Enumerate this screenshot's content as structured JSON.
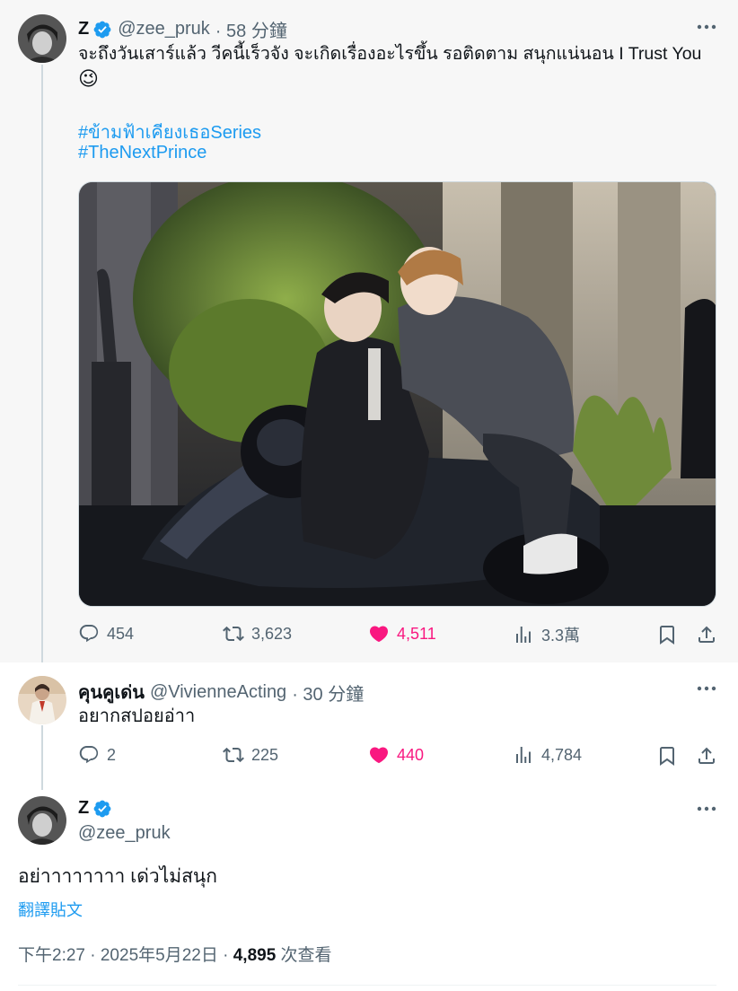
{
  "tweet1": {
    "display_name": "Z",
    "handle": "@zee_pruk",
    "time": "· 58 分鐘",
    "text_line1": "จะถึงวันเสาร์แล้ว วีคนี้เร็วจัง จะเกิดเรื่องอะไรขึ้น  รอติดตาม สนุกแน่นอน I Trust You",
    "emoji": "😉",
    "hashtags": [
      "#ข้ามฟ้าเคียงเธอSeries",
      "#TheNextPrince"
    ],
    "replies": "454",
    "reposts": "3,623",
    "likes": "4,511",
    "views": "3.3萬"
  },
  "tweet2": {
    "display_name": "คุนคูเด่น",
    "handle": "@VivienneActing",
    "time": "· 30 分鐘",
    "text": "อยากสปอยอ่าา",
    "replies": "2",
    "reposts": "225",
    "likes": "440",
    "views": "4,784"
  },
  "tweet3": {
    "display_name": "Z",
    "handle": "@zee_pruk",
    "text": "อย่าาาาาาาา เด่วไม่สนุก",
    "translate_label": "翻譯貼文",
    "timestamp": "下午2:27 · 2025年5月22日 · ",
    "views_count": "4,895",
    "views_label": " 次查看"
  },
  "colors": {
    "accent": "#1d9bf0",
    "like": "#f91880",
    "muted": "#536471",
    "thread_bg": "#f7f7f7"
  }
}
